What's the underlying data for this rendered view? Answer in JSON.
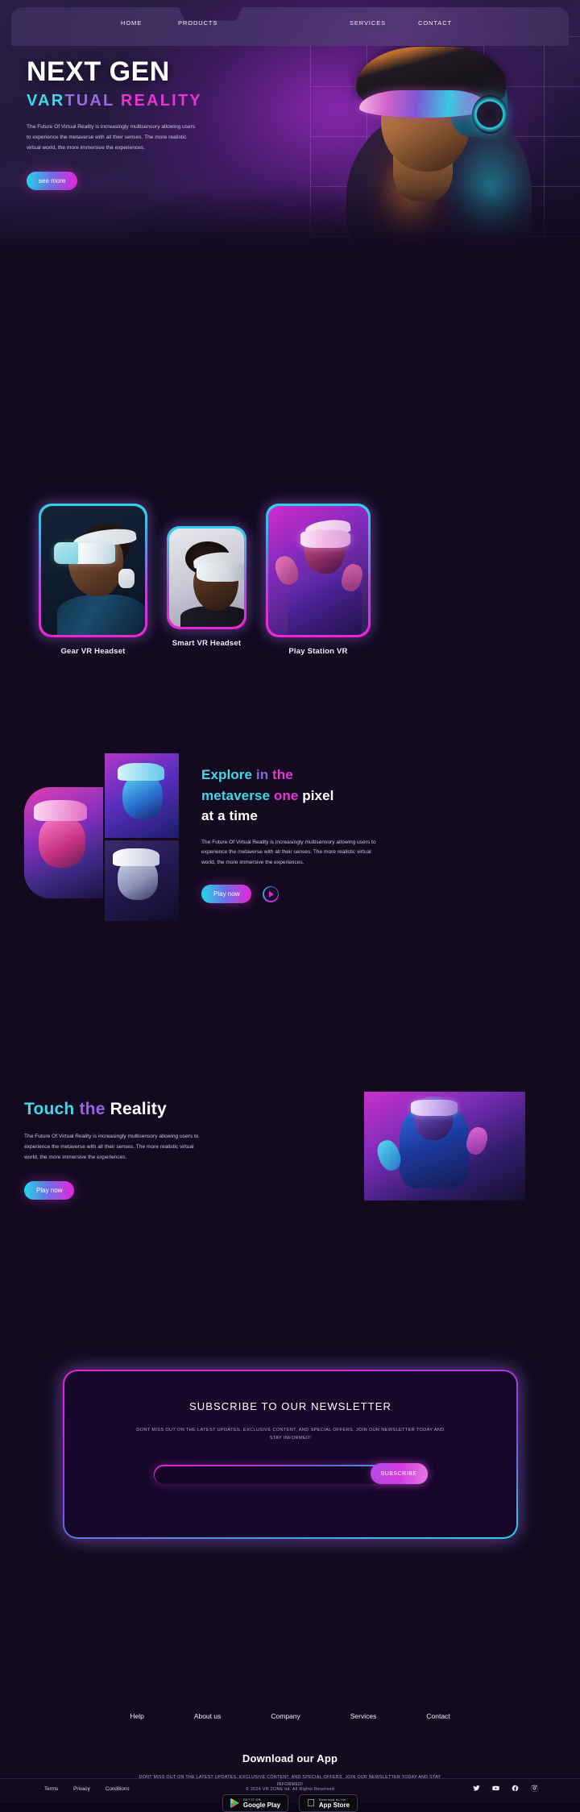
{
  "nav": {
    "items": [
      {
        "label": "HOME"
      },
      {
        "label": "PRODUCTS"
      },
      {
        "label": "SERVICES"
      },
      {
        "label": "CONTACT"
      }
    ]
  },
  "hero": {
    "title": "NEXT GEN",
    "subtitle_part1": "VAR",
    "subtitle_part2": "TUAL",
    "subtitle_part3": " REALITY",
    "paragraph": "The Future Of Virtual Reality is increasingly multisensory allowing users to experience the metaverse with all their senses. The more realistic virtual world, the more immersive the experiences.",
    "cta": "see more",
    "accent_cyan": "#3ed8e8",
    "accent_purple": "#9b6ae0",
    "accent_magenta": "#e833d6"
  },
  "products": {
    "cards": [
      {
        "label": "Gear VR Headset"
      },
      {
        "label": "Smart VR Headset"
      },
      {
        "label": "Play Station VR"
      }
    ]
  },
  "explore": {
    "heading_1": "Explore",
    "heading_2": " in",
    "heading_3": " the",
    "heading_4": "metaverse",
    "heading_5": " one",
    "heading_6": " pixel",
    "heading_7": "at a time",
    "paragraph": "The Future Of Virtual Reality is increasingly multisensory allowing users to experience the metaverse with all their senses. The more realistic virtual world, the more immersive the experiences.",
    "cta": "Play now"
  },
  "touch": {
    "heading_1": "Touch",
    "heading_2": " the",
    "heading_3": " Reality",
    "paragraph": "The Future Of Virtual Reality is increasingly multisensory allowing users to experience the metaverse with all their senses. The more realistic virtual world, the more immersive the experiences.",
    "cta": "Play now"
  },
  "newsletter": {
    "heading": "SUBSCRIBE TO OUR NEWSLETTER",
    "subtext": "DONT MISS OUT ON THE LATEST UPDATES, EXCLUSIVE CONTENT, AND SPECIAL OFFERS. JOIN OUR NEWSLETTER TODAY AND STAY INFORMED!",
    "input_placeholder": "",
    "input_value": "",
    "button": "SUBSCRIBE"
  },
  "footer": {
    "links": [
      {
        "label": "Help"
      },
      {
        "label": "About us"
      },
      {
        "label": "Company"
      },
      {
        "label": "Services"
      },
      {
        "label": "Contact"
      }
    ],
    "download_heading": "Download our App",
    "download_subtext": "DONT MISS OUT ON THE LATEST UPDATES, EXCLUSIVE CONTENT, AND SPECIAL OFFERS. JOIN OUR NEWSLETTER TODAY AND STAY INFORMED!",
    "badges": [
      {
        "small": "GET IT ON",
        "large": "Google Play"
      },
      {
        "small": "Download on the",
        "large": "App Store"
      }
    ],
    "legal_links": [
      {
        "label": "Terms"
      },
      {
        "label": "Privacy"
      },
      {
        "label": "Conditions"
      }
    ],
    "copyright": "© 2024 VR ZONE ltd. All Rights Reserved",
    "social": [
      "twitter-icon",
      "youtube-icon",
      "facebook-icon",
      "instagram-icon"
    ]
  }
}
